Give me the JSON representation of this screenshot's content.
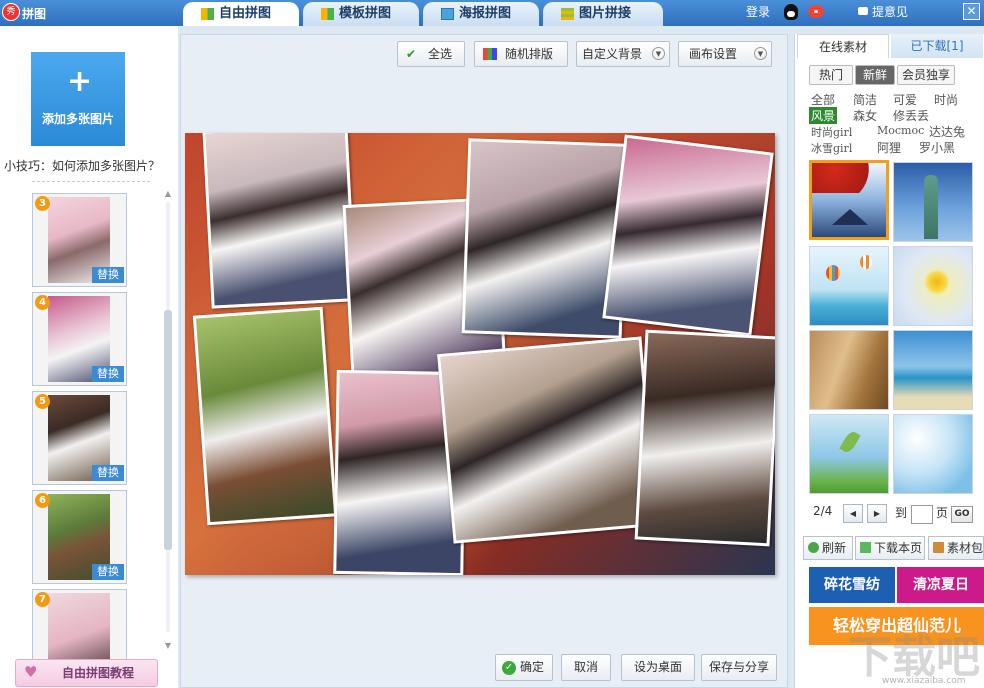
{
  "app": {
    "title": "拼图",
    "logo_text": "秀"
  },
  "tabs": [
    {
      "label": "自由拼图",
      "active": true,
      "icon": "free-collage-icon"
    },
    {
      "label": "模板拼图",
      "active": false,
      "icon": "template-icon"
    },
    {
      "label": "海报拼图",
      "active": false,
      "icon": "poster-icon"
    },
    {
      "label": "图片拼接",
      "active": false,
      "icon": "stitch-icon"
    }
  ],
  "header": {
    "login": "登录",
    "feedback": "提意见",
    "close": "✕"
  },
  "left": {
    "add_button": "添加多张图片",
    "add_plus": "+",
    "tip": "小技巧：如何添加多张图片？",
    "thumbs": [
      {
        "num": "3",
        "replace": "替换"
      },
      {
        "num": "4",
        "replace": "替换"
      },
      {
        "num": "5",
        "replace": "替换"
      },
      {
        "num": "6",
        "replace": "替换"
      },
      {
        "num": "7",
        "replace": ""
      }
    ],
    "tutorial": "自由拼图教程"
  },
  "toolbar": {
    "select_all": "全选",
    "random_layout": "随机排版",
    "custom_bg": "自定义背景",
    "canvas_settings": "画布设置"
  },
  "bottom": {
    "ok": "确定",
    "cancel": "取消",
    "set_desktop": "设为桌面",
    "save_share": "保存与分享"
  },
  "right": {
    "tab_online": "在线素材",
    "tab_downloaded": "已下载[1]",
    "subtabs": [
      "热门",
      "新鲜",
      "会员独享"
    ],
    "keywords": [
      "全部",
      "简洁",
      "可爱",
      "时尚",
      "风景",
      "森女",
      "修丢丢",
      "时尚girl",
      "Mocmoc",
      "达达兔",
      "冰雪girl",
      "阿狸",
      "罗小黑"
    ],
    "page_current": "2/4",
    "page_to": "到",
    "page_unit": "页",
    "go": "GO",
    "refresh": "刷新",
    "download_page": "下载本页",
    "material_pack": "素材包",
    "banner1": "碎花雪纺",
    "banner2": "清凉夏日",
    "banner3": "轻松穿出超仙范儿"
  },
  "watermark": {
    "big": "下载吧",
    "small": "www.xiazaiba.com"
  },
  "colors": {
    "accent_blue": "#2f6fbf",
    "selected_green": "#2f8a2f",
    "orange_badge": "#f39a12",
    "banner_blue": "#1d5fb0",
    "banner_pink": "#cc1a8a",
    "banner_orange": "#f7931e"
  }
}
